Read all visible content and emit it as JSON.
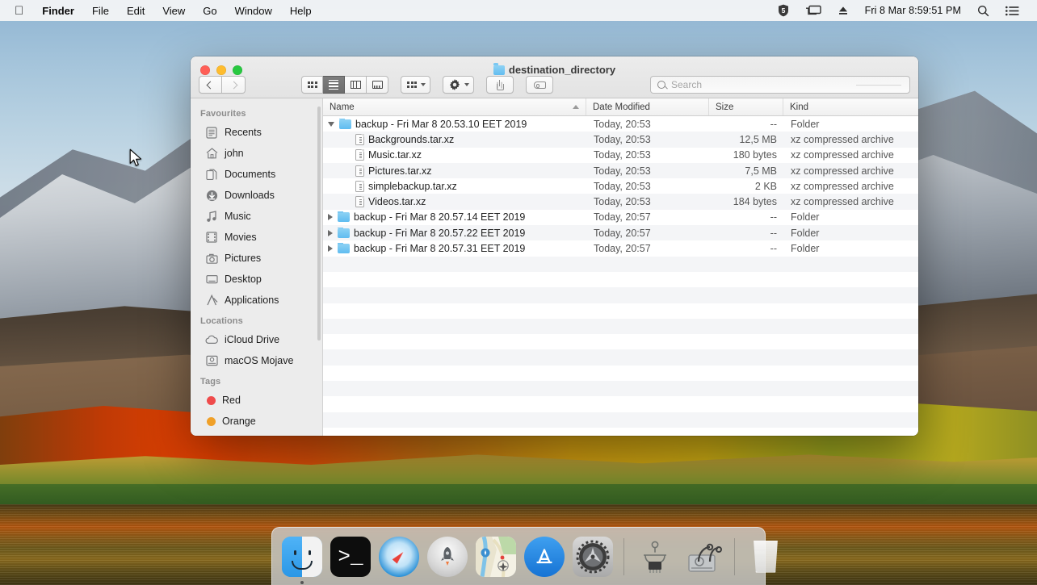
{
  "menubar": {
    "apple_icon": "apple-logo",
    "items": [
      {
        "label": "Finder",
        "bold": true
      },
      {
        "label": "File",
        "bold": false
      },
      {
        "label": "Edit",
        "bold": false
      },
      {
        "label": "View",
        "bold": false
      },
      {
        "label": "Go",
        "bold": false
      },
      {
        "label": "Window",
        "bold": false
      },
      {
        "label": "Help",
        "bold": false
      }
    ],
    "status": {
      "shield_badge": "5",
      "screen_mirror_icon": "screen-mirroring-icon",
      "eject_icon": "eject-icon",
      "clock": "Fri 8 Mar  8:59:51 PM",
      "spotlight_icon": "search-icon",
      "control_center_icon": "list-icon"
    }
  },
  "window": {
    "title": "destination_directory",
    "traffic_lights": {
      "close": "close-button",
      "minimize": "minimize-button",
      "zoom": "zoom-button"
    },
    "toolbar": {
      "back_label": "Back",
      "forward_label": "Forward",
      "views": [
        {
          "name": "icon-view",
          "label": "Icon View",
          "active": false
        },
        {
          "name": "list-view",
          "label": "List View",
          "active": true
        },
        {
          "name": "column-view",
          "label": "Column View",
          "active": false
        },
        {
          "name": "gallery-view",
          "label": "Gallery View",
          "active": false
        }
      ],
      "arrange_label": "Arrange",
      "action_label": "Action",
      "share_label": "Share",
      "tags_label": "Edit Tags"
    },
    "search": {
      "placeholder": "Search",
      "value": ""
    }
  },
  "sidebar": {
    "sections": [
      {
        "header": "Favourites",
        "items": [
          {
            "label": "Recents",
            "icon": "recents-icon"
          },
          {
            "label": "john",
            "icon": "home-icon"
          },
          {
            "label": "Documents",
            "icon": "documents-icon"
          },
          {
            "label": "Downloads",
            "icon": "downloads-icon"
          },
          {
            "label": "Music",
            "icon": "music-icon"
          },
          {
            "label": "Movies",
            "icon": "movies-icon"
          },
          {
            "label": "Pictures",
            "icon": "pictures-icon"
          },
          {
            "label": "Desktop",
            "icon": "desktop-icon"
          },
          {
            "label": "Applications",
            "icon": "applications-icon"
          }
        ]
      },
      {
        "header": "Locations",
        "items": [
          {
            "label": "iCloud Drive",
            "icon": "icloud-icon"
          },
          {
            "label": "macOS Mojave",
            "icon": "harddisk-icon"
          }
        ]
      },
      {
        "header": "Tags",
        "items": [
          {
            "label": "Red",
            "icon": "tag-dot",
            "color": "#ef4b4b"
          },
          {
            "label": "Orange",
            "icon": "tag-dot",
            "color": "#f0a028"
          }
        ]
      }
    ]
  },
  "filelist": {
    "columns": [
      {
        "label": "Name",
        "sorted": "asc"
      },
      {
        "label": "Date Modified",
        "sorted": ""
      },
      {
        "label": "Size",
        "sorted": ""
      },
      {
        "label": "Kind",
        "sorted": ""
      }
    ],
    "rows": [
      {
        "name": "backup - Fri Mar  8 20.53.10 EET 2019",
        "date": "Today, 20:53",
        "size": "--",
        "kind": "Folder",
        "type": "folder",
        "disclosure": "open",
        "indent": 0
      },
      {
        "name": "Backgrounds.tar.xz",
        "date": "Today, 20:53",
        "size": "12,5 MB",
        "kind": "xz compressed archive",
        "type": "file",
        "disclosure": "none",
        "indent": 1
      },
      {
        "name": "Music.tar.xz",
        "date": "Today, 20:53",
        "size": "180 bytes",
        "kind": "xz compressed archive",
        "type": "file",
        "disclosure": "none",
        "indent": 1
      },
      {
        "name": "Pictures.tar.xz",
        "date": "Today, 20:53",
        "size": "7,5 MB",
        "kind": "xz compressed archive",
        "type": "file",
        "disclosure": "none",
        "indent": 1
      },
      {
        "name": "simplebackup.tar.xz",
        "date": "Today, 20:53",
        "size": "2 KB",
        "kind": "xz compressed archive",
        "type": "file",
        "disclosure": "none",
        "indent": 1
      },
      {
        "name": "Videos.tar.xz",
        "date": "Today, 20:53",
        "size": "184 bytes",
        "kind": "xz compressed archive",
        "type": "file",
        "disclosure": "none",
        "indent": 1
      },
      {
        "name": "backup - Fri Mar  8 20.57.14 EET 2019",
        "date": "Today, 20:57",
        "size": "--",
        "kind": "Folder",
        "type": "folder",
        "disclosure": "closed",
        "indent": 0
      },
      {
        "name": "backup - Fri Mar  8 20.57.22 EET 2019",
        "date": "Today, 20:57",
        "size": "--",
        "kind": "Folder",
        "type": "folder",
        "disclosure": "closed",
        "indent": 0
      },
      {
        "name": "backup - Fri Mar  8 20.57.31 EET 2019",
        "date": "Today, 20:57",
        "size": "--",
        "kind": "Folder",
        "type": "folder",
        "disclosure": "closed",
        "indent": 0
      }
    ]
  },
  "dock": {
    "items": [
      {
        "label": "Finder",
        "icon": "finder-icon",
        "running": true
      },
      {
        "label": "Terminal",
        "icon": "terminal-icon",
        "running": false
      },
      {
        "label": "Safari",
        "icon": "safari-icon",
        "running": false
      },
      {
        "label": "Launchpad",
        "icon": "launchpad-icon",
        "running": false
      },
      {
        "label": "Maps",
        "icon": "maps-icon",
        "running": false
      },
      {
        "label": "App Store",
        "icon": "app-store-icon",
        "running": false
      },
      {
        "label": "System Preferences",
        "icon": "system-preferences-icon",
        "running": false
      },
      {
        "label": "separator",
        "icon": "dock-separator",
        "running": false
      },
      {
        "label": "Circuit Utility",
        "icon": "circuit-icon",
        "running": false
      },
      {
        "label": "Disk Utility",
        "icon": "disk-utility-icon",
        "running": false
      },
      {
        "label": "separator",
        "icon": "dock-separator",
        "running": false
      },
      {
        "label": "Trash",
        "icon": "trash-icon",
        "running": false
      }
    ],
    "terminal_prompt": ">_",
    "appstore_glyph": "A",
    "launchpad_glyph": "🚀"
  }
}
